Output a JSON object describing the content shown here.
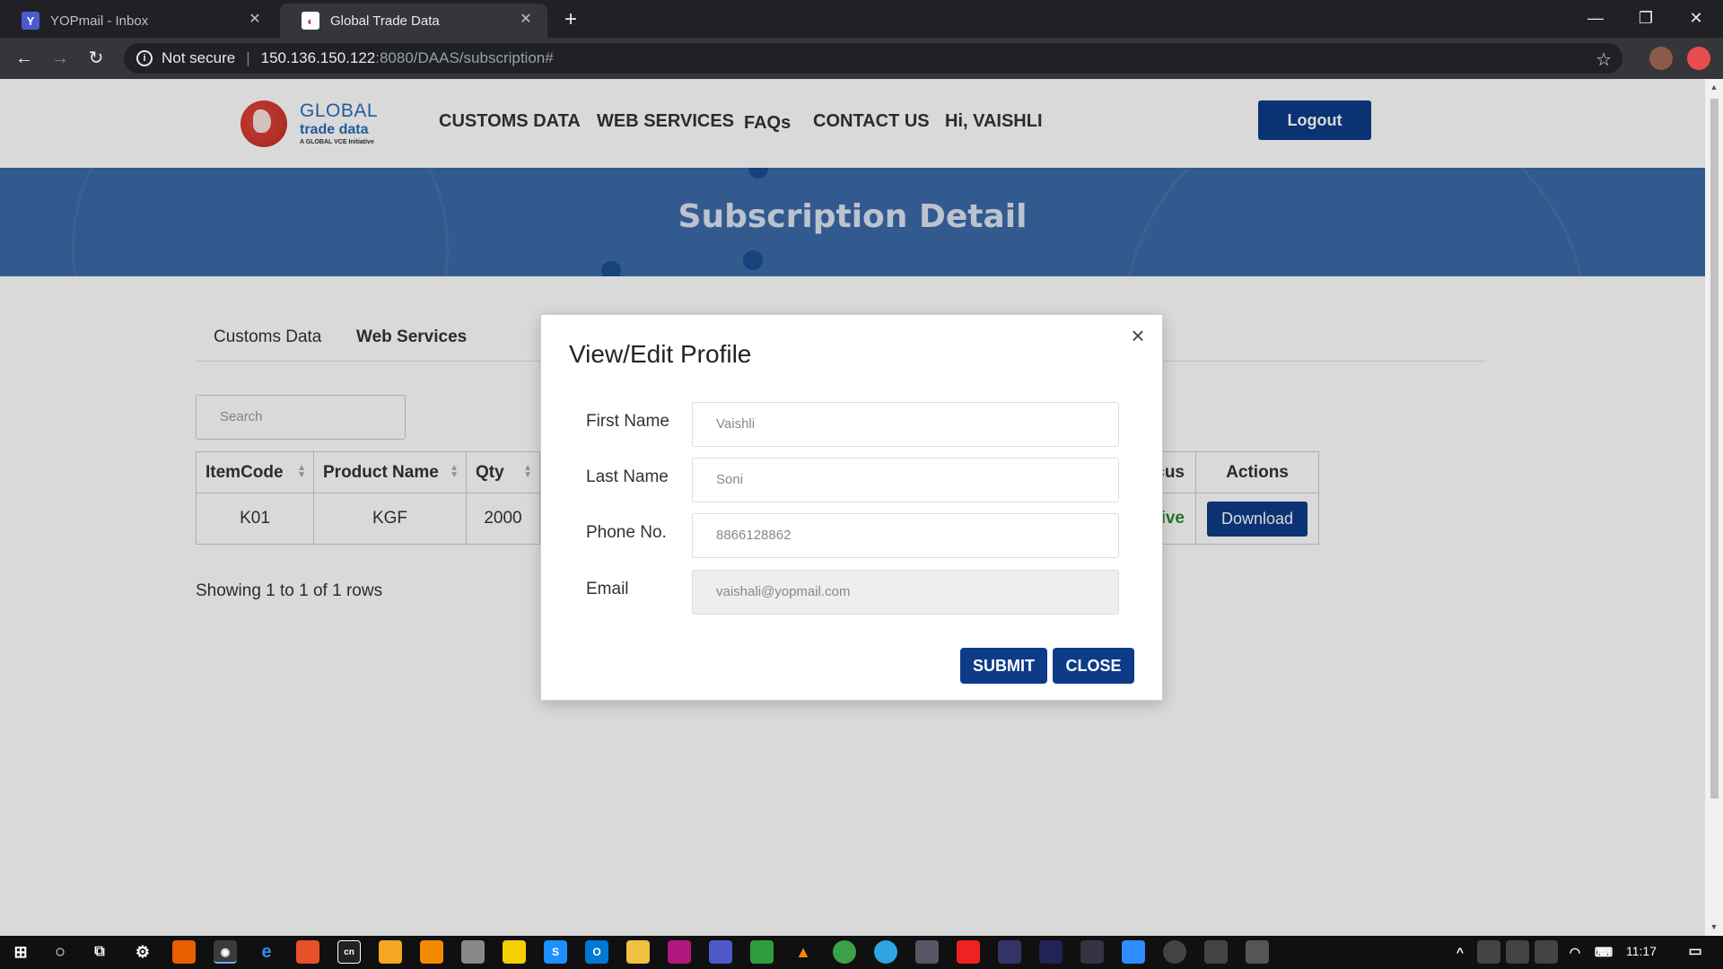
{
  "browser": {
    "tabs": [
      {
        "title": "YOPmail - Inbox",
        "active": false
      },
      {
        "title": "Global Trade Data",
        "active": true
      }
    ],
    "security_label": "Not secure",
    "url_host": "150.136.150.122",
    "url_path": ":8080/DAAS/subscription#"
  },
  "header": {
    "logo": {
      "line1": "GLOBAL",
      "line2": "trade data",
      "line3": "A GLOBAL VCE Initiative"
    },
    "nav": [
      "CUSTOMS DATA",
      "WEB SERVICES",
      "FAQs",
      "CONTACT US"
    ],
    "greeting": "Hi, VAISHLI",
    "logout_label": "Logout"
  },
  "banner": {
    "title": "Subscription Detail"
  },
  "content": {
    "tabs": [
      "Customs Data",
      "Web Services"
    ],
    "search_placeholder": "Search",
    "table": {
      "columns": [
        "ItemCode",
        "Product Name",
        "Qty"
      ],
      "row": [
        "K01",
        "KGF",
        "2000"
      ],
      "status_header": "cus",
      "status_value": "ive",
      "actions_header": "Actions",
      "download_label": "Download"
    },
    "rows_info": "Showing 1 to 1 of 1 rows"
  },
  "modal": {
    "title": "View/Edit Profile",
    "close_symbol": "×",
    "fields": [
      {
        "label": "First Name",
        "value": "Vaishli"
      },
      {
        "label": "Last Name",
        "value": "Soni"
      },
      {
        "label": "Phone No.",
        "value": "8866128862"
      },
      {
        "label": "Email",
        "value": "vaishali@yopmail.com"
      }
    ],
    "submit_label": "SUBMIT",
    "close_label": "CLOSE"
  },
  "taskbar": {
    "time": "11:17"
  },
  "colors": {
    "brand_blue": "#0d3b87",
    "banner_blue": "#3c6aa9",
    "active_green": "#2a8a2a"
  }
}
